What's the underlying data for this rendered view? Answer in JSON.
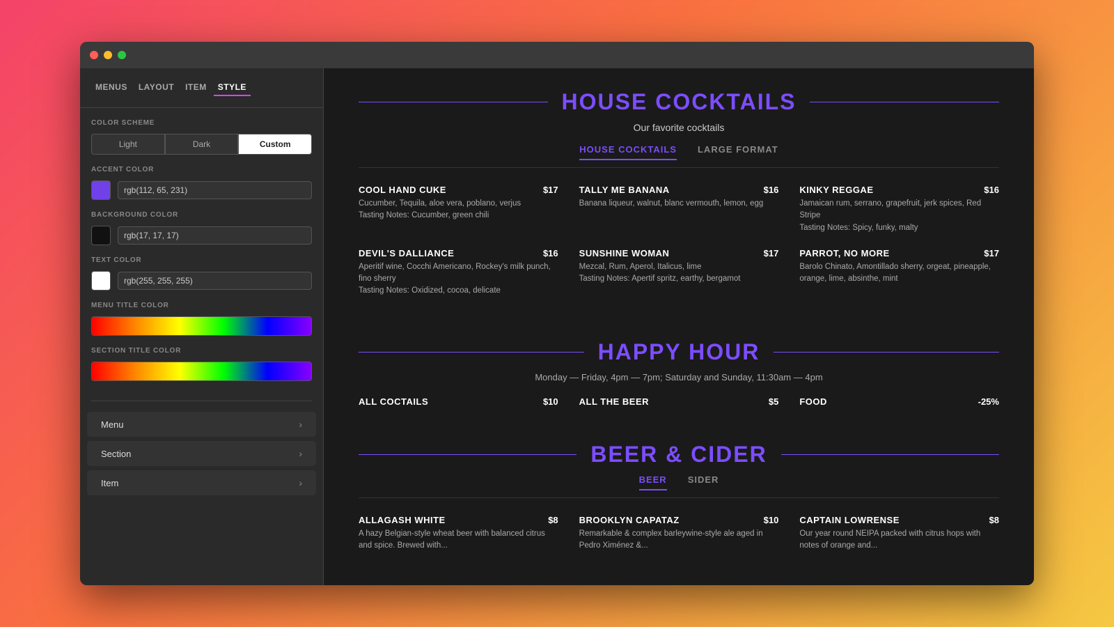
{
  "window": {
    "titlebar": {
      "dots": [
        "red",
        "yellow",
        "green"
      ]
    }
  },
  "sidebar": {
    "tabs": [
      {
        "id": "menus",
        "label": "MENUS",
        "active": false
      },
      {
        "id": "layout",
        "label": "LAYOUT",
        "active": false
      },
      {
        "id": "item",
        "label": "ITEM",
        "active": false
      },
      {
        "id": "style",
        "label": "STYLE",
        "active": true
      }
    ],
    "color_scheme": {
      "label": "COLOR SCHEME",
      "options": [
        {
          "label": "Light",
          "active": false
        },
        {
          "label": "Dark",
          "active": false
        },
        {
          "label": "Custom",
          "active": true
        }
      ]
    },
    "accent_color": {
      "label": "ACCENT COLOR",
      "swatch": "#7040e8",
      "value": "rgb(112, 65, 231)"
    },
    "background_color": {
      "label": "BACKGROUND COLOR",
      "swatch": "#111111",
      "value": "rgb(17, 17, 17)"
    },
    "text_color": {
      "label": "TEXT COLOR",
      "swatch": "#ffffff",
      "value": "rgb(255, 255, 255)"
    },
    "menu_title_color": {
      "label": "MENU TITLE COLOR"
    },
    "section_title_color": {
      "label": "SECTION TITLE COLOR"
    },
    "nav_items": [
      {
        "label": "Menu"
      },
      {
        "label": "Section"
      },
      {
        "label": "Item"
      }
    ]
  },
  "main": {
    "sections": [
      {
        "id": "house-cocktails",
        "title": "HOUSE COCKTAILS",
        "subtitle": "Our favorite cocktails",
        "tabs": [
          {
            "label": "HOUSE COCKTAILS",
            "active": true
          },
          {
            "label": "LARGE FORMAT",
            "active": false
          }
        ],
        "items": [
          {
            "name": "COOL HAND CUKE",
            "price": "$17",
            "desc": "Cucumber, Tequila, aloe vera, poblano, verjus\nTasting Notes: Cucumber, green chili"
          },
          {
            "name": "TALLY ME BANANA",
            "price": "$16",
            "desc": "Banana liqueur, walnut, blanc vermouth, lemon, egg"
          },
          {
            "name": "KINKY REGGAE",
            "price": "$16",
            "desc": "Jamaican rum, serrano, grapefruit, jerk spices, Red Stripe\nTasting Notes: Spicy, funky, malty"
          },
          {
            "name": "DEVIL'S DALLIANCE",
            "price": "$16",
            "desc": "Aperitif wine, Cocchi Americano, Rockey's milk punch, fino sherry\nTasting Notes: Oxidized, cocoa, delicate"
          },
          {
            "name": "SUNSHINE WOMAN",
            "price": "$17",
            "desc": "Mezcal, Rum, Aperol, Italicus, lime\nTasting Notes: Apertif spritz, earthy, bergamot"
          },
          {
            "name": "PARROT, NO MORE",
            "price": "$17",
            "desc": "Barolo Chinato, Amontillado sherry, orgeat, pineapple, orange, lime, absinthe, mint"
          }
        ]
      },
      {
        "id": "happy-hour",
        "title": "HAPPY HOUR",
        "subtitle": "Monday — Friday, 4pm — 7pm; Saturday and Sunday, 11:30am — 4pm",
        "tabs": [],
        "simple_items": [
          {
            "name": "ALL COCTAILS",
            "price": "$10"
          },
          {
            "name": "ALL THE BEER",
            "price": "$5"
          },
          {
            "name": "FOOD",
            "price": "-25%"
          }
        ]
      },
      {
        "id": "beer-cider",
        "title": "BEER & CIDER",
        "subtitle": "",
        "tabs": [
          {
            "label": "BEER",
            "active": true
          },
          {
            "label": "SIDER",
            "active": false
          }
        ],
        "items": [
          {
            "name": "ALLAGASH WHITE",
            "price": "$8",
            "desc": "A hazy Belgian-style wheat beer with balanced citrus and spice. Brewed with..."
          },
          {
            "name": "BROOKLYN CAPATAZ",
            "price": "$10",
            "desc": "Remarkable & complex barleywine-style ale aged in Pedro Ximénez &..."
          },
          {
            "name": "CAPTAIN LOWRENSE",
            "price": "$8",
            "desc": "Our year round NEIPA packed with citrus hops with notes of orange and..."
          }
        ]
      }
    ]
  }
}
